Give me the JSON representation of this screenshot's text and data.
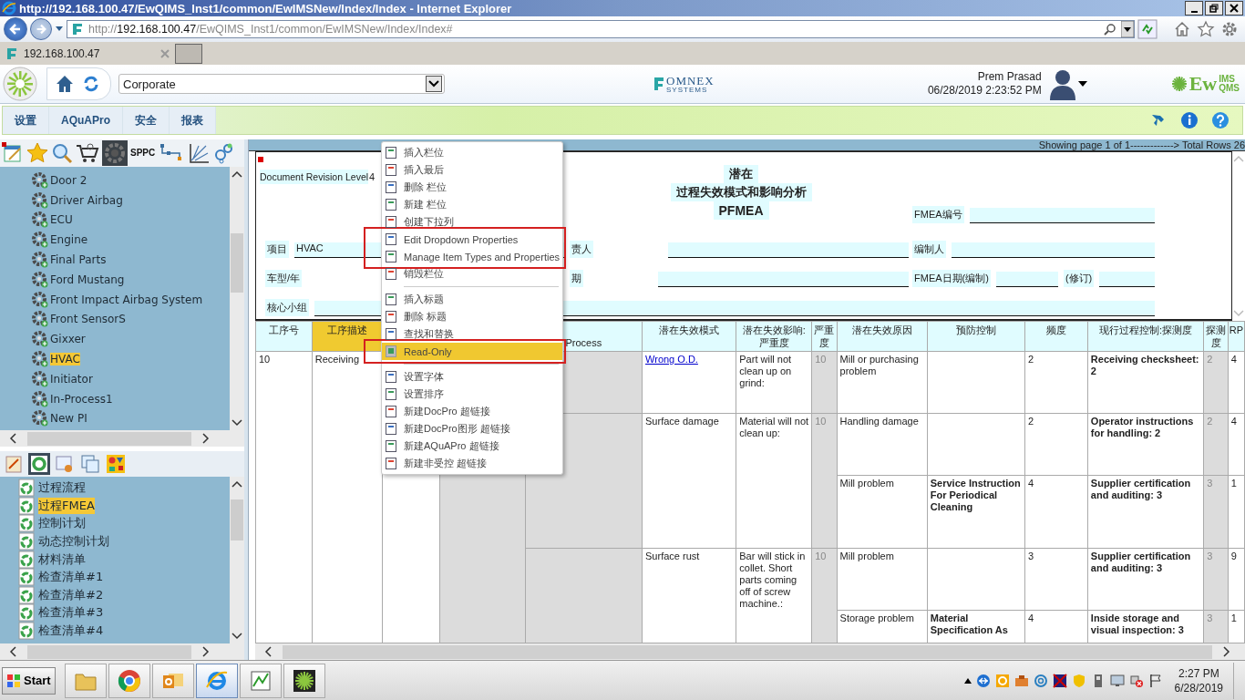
{
  "browser": {
    "title": "http://192.168.100.47/EwQIMS_Inst1/common/EwIMSNew/Index/Index - Internet Explorer",
    "url_prefix": "http://",
    "url_host": "192.168.100.47",
    "url_path": "/EwQIMS_Inst1/common/EwIMSNew/Index/Index#",
    "tab": "192.168.100.47"
  },
  "header": {
    "site": "Corporate",
    "omnex": "OMNEX",
    "omnex_sub": "SYSTEMS",
    "user": "Prem Prasad",
    "datetime": "06/28/2019 2:23:52 PM",
    "brand": "Ew",
    "brand_top": "IMS",
    "brand_bottom": "QMS"
  },
  "menu": [
    "设置",
    "AQuAPro",
    "安全",
    "报表"
  ],
  "toolbar_label": "SPPC",
  "tree": [
    {
      "label": "Door 2",
      "selected": false
    },
    {
      "label": "Driver Airbag",
      "selected": false
    },
    {
      "label": "ECU",
      "selected": false
    },
    {
      "label": "Engine",
      "selected": false
    },
    {
      "label": "Final Parts",
      "selected": false
    },
    {
      "label": "Ford Mustang",
      "selected": false
    },
    {
      "label": "Front Impact Airbag System",
      "selected": false
    },
    {
      "label": "Front SensorS",
      "selected": false
    },
    {
      "label": "Gixxer",
      "selected": false
    },
    {
      "label": "HVAC",
      "selected": true
    },
    {
      "label": "Initiator",
      "selected": false
    },
    {
      "label": "In-Process1",
      "selected": false
    },
    {
      "label": "New PI",
      "selected": false
    }
  ],
  "doc_tabs": [
    {
      "selected": false
    },
    {
      "selected": true
    },
    {
      "selected": false
    },
    {
      "selected": false
    },
    {
      "selected": false
    }
  ],
  "documents": [
    {
      "label": "过程流程",
      "selected": false
    },
    {
      "label": "过程FMEA",
      "selected": true
    },
    {
      "label": "控制计划",
      "selected": false
    },
    {
      "label": "动态控制计划",
      "selected": false
    },
    {
      "label": "材料清单",
      "selected": false
    },
    {
      "label": "检查清单#1",
      "selected": false
    },
    {
      "label": "检查清单#2",
      "selected": false
    },
    {
      "label": "检查清单#3",
      "selected": false
    },
    {
      "label": "检查清单#4",
      "selected": false
    }
  ],
  "status": "Showing page 1 of 1-------------> Total Rows 26",
  "form": {
    "revision_label": "Document Revision Level",
    "revision_value": "4",
    "title_1": "潜在",
    "title_2": "过程失效模式和影响分析",
    "title_3": "PFMEA",
    "item_label": "项目",
    "item_value": "HVAC",
    "owner_label": "责人",
    "number_label": "FMEA编号",
    "model_label": "车型/年",
    "date_label": "期",
    "preparer_label": "编制人",
    "fmea_date_label": "FMEA日期(编制)",
    "revised_label": "(修订)",
    "team_label": "核心小组"
  },
  "table": {
    "columns": [
      {
        "label": "工序号",
        "highlighted": false
      },
      {
        "label": "工序描述",
        "highlighted": true
      },
      {
        "label": "Process",
        "highlighted": false
      },
      {
        "label": "潜在失效模式",
        "highlighted": false
      },
      {
        "label": "潜在失效影响:严重度",
        "highlighted": false
      },
      {
        "label": "严重度",
        "highlighted": false
      },
      {
        "label": "潜在失效原因",
        "highlighted": false
      },
      {
        "label": "预防控制",
        "highlighted": false
      },
      {
        "label": "频度",
        "highlighted": false
      },
      {
        "label": "现行过程控制:探测度",
        "highlighted": false
      },
      {
        "label": "探测度",
        "highlighted": false
      },
      {
        "label": "RP",
        "highlighted": false
      }
    ],
    "process": {
      "number": "10",
      "description": "Receiving",
      "modes": [
        {
          "mode": "Wrong O.D.",
          "linked": true,
          "effect": "Part will not clean up on grind:",
          "severity": "10",
          "causes": [
            {
              "cause": "Mill or purchasing problem",
              "occurrence": "2",
              "control": "Receiving checksheet: 2",
              "detection": "2",
              "rpn": "4"
            }
          ]
        },
        {
          "mode": "Surface damage",
          "linked": false,
          "effect": "Material will not clean up:",
          "severity": "10",
          "causes": [
            {
              "cause": "Handling damage",
              "occurrence": "2",
              "control": "Operator instructions for handling: 2",
              "detection": "2",
              "rpn": "4"
            },
            {
              "cause": "Mill problem",
              "prevention": "Service Instruction For Periodical Cleaning",
              "occurrence": "4",
              "control": "Supplier certification and auditing: 3",
              "detection": "3",
              "rpn": "1"
            }
          ]
        },
        {
          "mode": "Surface rust",
          "linked": false,
          "effect": "Bar will stick in collet. Short parts coming off of screw machine.:",
          "severity": "10",
          "causes": [
            {
              "cause": "Mill problem",
              "occurrence": "3",
              "control": "Supplier certification and auditing: 3",
              "detection": "3",
              "rpn": "9"
            },
            {
              "cause": "Storage problem",
              "prevention": "Material Specification As",
              "occurrence": "4",
              "control": "Inside storage and visual inspection: 3",
              "detection": "3",
              "rpn": "1"
            }
          ]
        }
      ]
    }
  },
  "context_menu": [
    {
      "kind": "item",
      "label": "插入栏位",
      "selected": false,
      "framed": false
    },
    {
      "kind": "item",
      "label": "插入最后",
      "selected": false,
      "framed": false
    },
    {
      "kind": "item",
      "label": "删除 栏位",
      "selected": false,
      "framed": false
    },
    {
      "kind": "item",
      "label": "新建 栏位",
      "selected": false,
      "framed": false
    },
    {
      "kind": "item",
      "label": "创建下拉列",
      "selected": false,
      "framed": false
    },
    {
      "kind": "item",
      "label": "Edit Dropdown Properties",
      "selected": false,
      "framed": true
    },
    {
      "kind": "item",
      "label": "Manage Item Types and Properties",
      "selected": false,
      "framed": true
    },
    {
      "kind": "item",
      "label": "销毁栏位",
      "selected": false,
      "framed": false
    },
    {
      "kind": "separator"
    },
    {
      "kind": "item",
      "label": "插入标题",
      "selected": false,
      "framed": false
    },
    {
      "kind": "item",
      "label": "删除 标题",
      "selected": false,
      "framed": false
    },
    {
      "kind": "item",
      "label": "查找和替换",
      "selected": false,
      "framed": false
    },
    {
      "kind": "item",
      "label": "Read-Only",
      "selected": true,
      "framed": true
    },
    {
      "kind": "separator"
    },
    {
      "kind": "item",
      "label": "设置字体",
      "selected": false,
      "framed": false
    },
    {
      "kind": "item",
      "label": "设置排序",
      "selected": false,
      "framed": false
    },
    {
      "kind": "item",
      "label": "新建DocPro 超链接",
      "selected": false,
      "framed": false
    },
    {
      "kind": "item",
      "label": "新建DocPro图形 超链接",
      "selected": false,
      "framed": false
    },
    {
      "kind": "item",
      "label": "新建AQuAPro 超链接",
      "selected": false,
      "framed": false
    },
    {
      "kind": "item",
      "label": "新建非受控 超链接",
      "selected": false,
      "framed": false
    }
  ],
  "taskbar": {
    "start": "Start",
    "time": "2:27 PM",
    "date": "6/28/2019"
  }
}
